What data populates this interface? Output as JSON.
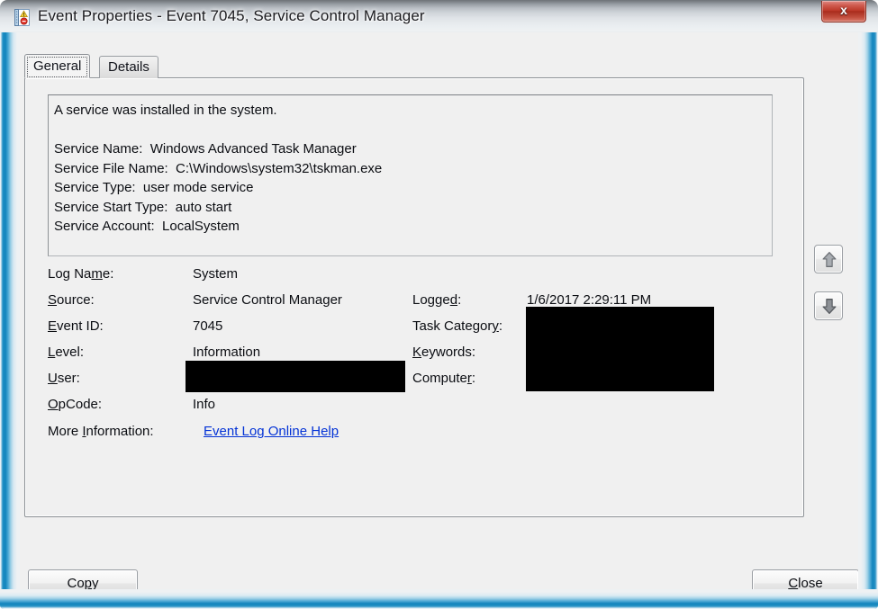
{
  "window": {
    "title": "Event Properties - Event 7045, Service Control Manager",
    "icon": "event-log-icon",
    "close_label": "x"
  },
  "tabs": [
    {
      "id": "general",
      "label": "General",
      "active": true
    },
    {
      "id": "details",
      "label": "Details",
      "active": false
    }
  ],
  "description": "A service was installed in the system.\n\nService Name:  Windows Advanced Task Manager\nService File Name:  C:\\Windows\\system32\\tskman.exe\nService Type:  user mode service\nService Start Type:  auto start\nService Account:  LocalSystem",
  "fields": {
    "left": [
      {
        "label_pre": "Log Na",
        "label_acc": "m",
        "label_post": "e:",
        "value": "System",
        "redacted": false
      },
      {
        "label_pre": "",
        "label_acc": "S",
        "label_post": "ource:",
        "value": "Service Control Manager",
        "redacted": false
      },
      {
        "label_pre": "",
        "label_acc": "E",
        "label_post": "vent ID:",
        "value": "7045",
        "redacted": false
      },
      {
        "label_pre": "",
        "label_acc": "L",
        "label_post": "evel:",
        "value": "Information",
        "redacted": false
      },
      {
        "label_pre": "",
        "label_acc": "U",
        "label_post": "ser:",
        "value": "",
        "redacted": true
      },
      {
        "label_pre": "",
        "label_acc": "O",
        "label_post": "pCode:",
        "value": "Info",
        "redacted": false
      }
    ],
    "right": [
      {
        "label_pre": "Logge",
        "label_acc": "d",
        "label_post": ":",
        "value": "1/6/2017 2:29:11 PM",
        "redacted": false
      },
      {
        "label_pre": "Task Categor",
        "label_acc": "y",
        "label_post": ":",
        "value": "",
        "redacted": true
      },
      {
        "label_pre": "",
        "label_acc": "K",
        "label_post": "eywords:",
        "value": "",
        "redacted": true
      },
      {
        "label_pre": "Compute",
        "label_acc": "r",
        "label_post": ":",
        "value": "",
        "redacted": true
      }
    ],
    "more_information": {
      "label_pre": "More ",
      "label_acc": "I",
      "label_post": "nformation:",
      "link_text": "Event Log Online Help"
    }
  },
  "nav": {
    "up_label": "up-arrow",
    "down_label": "down-arrow"
  },
  "buttons": {
    "copy_pre": "Co",
    "copy_acc": "p",
    "copy_post": "y",
    "close_acc": "C",
    "close_post": "lose"
  },
  "colors": {
    "link": "#0433d6",
    "redaction": "#000000",
    "dialog_bg": "#f0f0f0",
    "close_button": "#bb3727",
    "frame_glass": "#1184bd"
  }
}
